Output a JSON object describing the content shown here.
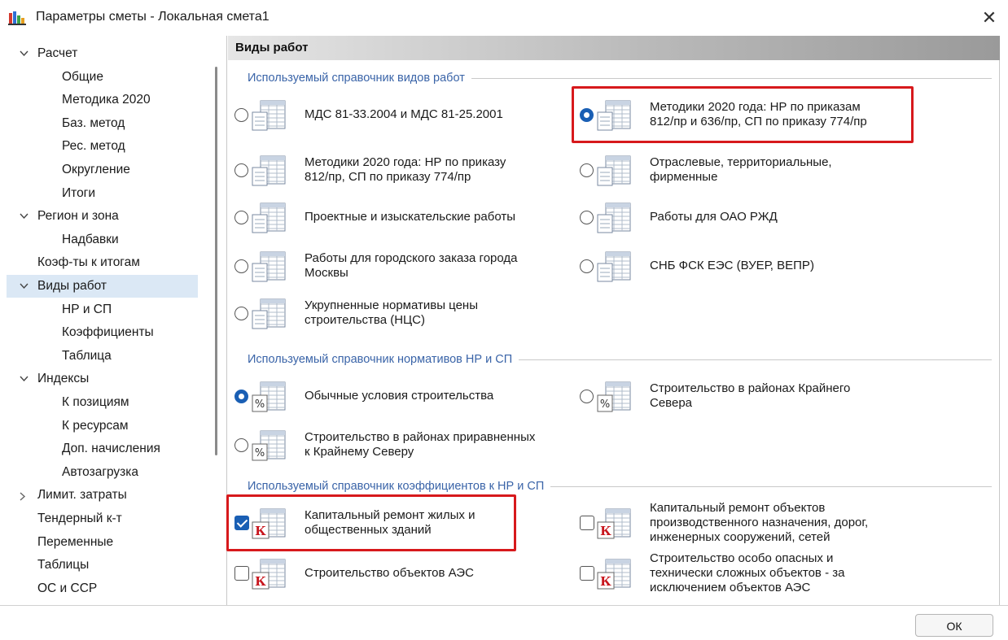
{
  "window": {
    "title": "Параметры сметы - Локальная смета1",
    "close_glyph": "✕"
  },
  "sidebar": {
    "items": [
      {
        "label": "Расчет",
        "level": 0,
        "expander": "expanded"
      },
      {
        "label": "Общие",
        "level": 1
      },
      {
        "label": "Методика 2020",
        "level": 1
      },
      {
        "label": "Баз. метод",
        "level": 1
      },
      {
        "label": "Рес. метод",
        "level": 1
      },
      {
        "label": "Округление",
        "level": 1
      },
      {
        "label": "Итоги",
        "level": 1
      },
      {
        "label": "Регион и зона",
        "level": 0,
        "expander": "expanded"
      },
      {
        "label": "Надбавки",
        "level": 1
      },
      {
        "label": "Коэф-ты к итогам",
        "level": 0
      },
      {
        "label": "Виды работ",
        "level": 0,
        "expander": "expanded",
        "selected": true
      },
      {
        "label": "НР и СП",
        "level": 1
      },
      {
        "label": "Коэффициенты",
        "level": 1
      },
      {
        "label": "Таблица",
        "level": 1
      },
      {
        "label": "Индексы",
        "level": 0,
        "expander": "expanded"
      },
      {
        "label": "К позициям",
        "level": 1
      },
      {
        "label": "К ресурсам",
        "level": 1
      },
      {
        "label": "Доп. начисления",
        "level": 1
      },
      {
        "label": "Автозагрузка",
        "level": 1
      },
      {
        "label": "Лимит. затраты",
        "level": 0,
        "expander": "collapsed"
      },
      {
        "label": "Тендерный к-т",
        "level": 0
      },
      {
        "label": "Переменные",
        "level": 0
      },
      {
        "label": "Таблицы",
        "level": 0
      },
      {
        "label": "ОС и ССР",
        "level": 0
      }
    ]
  },
  "panel": {
    "header": "Виды работ",
    "groups": [
      {
        "title": "Используемый справочник видов работ",
        "control": "radio",
        "icon": "table-doc-icon",
        "options": [
          {
            "l1": "МДС 81-33.2004 и МДС 81-25.2001",
            "l2": "",
            "checked": false
          },
          {
            "l1": "Методики 2020 года: НР по приказам",
            "l2": "812/пр и 636/пр, СП по приказу 774/пр",
            "checked": true,
            "highlight": true
          },
          {
            "l1": "Методики 2020 года: НР по приказу",
            "l2": "812/пр, СП по приказу 774/пр",
            "checked": false
          },
          {
            "l1": "Отраслевые, территориальные,",
            "l2": "фирменные",
            "checked": false
          },
          {
            "l1": "Проектные и изыскательские работы",
            "l2": "",
            "checked": false
          },
          {
            "l1": "Работы для ОАО РЖД",
            "l2": "",
            "checked": false
          },
          {
            "l1": "Работы для городского заказа города",
            "l2": "Москвы",
            "checked": false
          },
          {
            "l1": "СНБ ФСК ЕЭС (ВУЕР, ВЕПР)",
            "l2": "",
            "checked": false
          },
          {
            "l1": "Укрупненные нормативы цены",
            "l2": "строительства (НЦС)",
            "checked": false
          }
        ]
      },
      {
        "title": "Используемый справочник нормативов НР и СП",
        "control": "radio",
        "icon": "percent-table-icon",
        "options": [
          {
            "l1": "Обычные условия строительства",
            "l2": "",
            "checked": true
          },
          {
            "l1": "Строительство в районах Крайнего",
            "l2": "Севера",
            "checked": false
          },
          {
            "l1": "Строительство в районах приравненных",
            "l2": "к Крайнему Северу",
            "checked": false
          }
        ]
      },
      {
        "title": "Используемый справочник коэффициентов к НР и СП",
        "control": "checkbox",
        "icon": "k-table-icon",
        "options": [
          {
            "l1": "Капитальный ремонт жилых и",
            "l2": "общественных зданий",
            "l3": "",
            "checked": true,
            "highlight": true
          },
          {
            "l1": "Капитальный ремонт объектов",
            "l2": "производственного назначения, дорог,",
            "l3": "инженерных сооружений, сетей",
            "checked": false
          },
          {
            "l1": "Строительство объектов АЭС",
            "l2": "",
            "l3": "",
            "checked": false
          },
          {
            "l1": "Строительство особо опасных и",
            "l2": "технически сложных объектов - за",
            "l3": "исключением объектов АЭС",
            "checked": false
          }
        ]
      }
    ]
  },
  "footer": {
    "ok_label": "ОК"
  },
  "colors": {
    "accent": "#1a5fb4",
    "highlight": "#d7191c",
    "group_title": "#3a64a8",
    "selected_row": "#dbe8f5"
  }
}
